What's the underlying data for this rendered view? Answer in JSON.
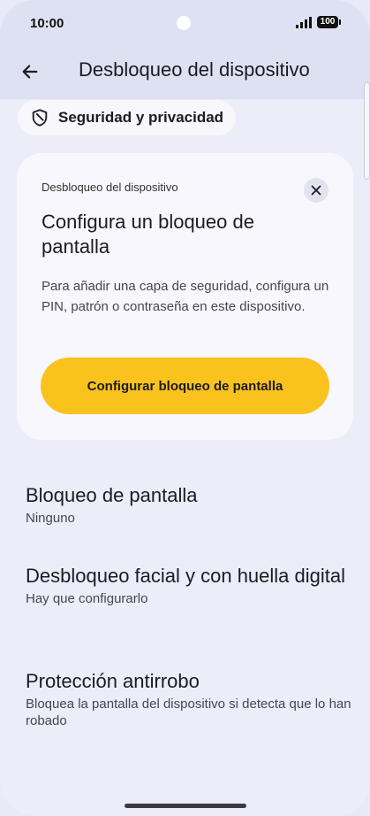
{
  "status_bar": {
    "time": "10:00",
    "battery": "100"
  },
  "app_bar": {
    "title": "Desbloqueo del dispositivo"
  },
  "chip": {
    "label": "Seguridad y privacidad"
  },
  "card": {
    "eyebrow": "Desbloqueo del dispositivo",
    "title": "Configura un bloqueo de pantalla",
    "body": "Para añadir una capa de seguridad, configura un PIN, patrón o contraseña en este dispositivo.",
    "button_label": "Configurar bloqueo de pantalla"
  },
  "settings": [
    {
      "title": "Bloqueo de pantalla",
      "subtitle": "Ninguno"
    },
    {
      "title": "Desbloqueo facial y con huella digital",
      "subtitle": "Hay que configurarlo"
    },
    {
      "title": "Protección antirrobo",
      "subtitle": "Bloquea la pantalla del dispositivo si detecta que lo han robado"
    }
  ],
  "colors": {
    "accent": "#f9c21d",
    "background": "#ecedf9",
    "app_bar": "#dde1f2"
  }
}
